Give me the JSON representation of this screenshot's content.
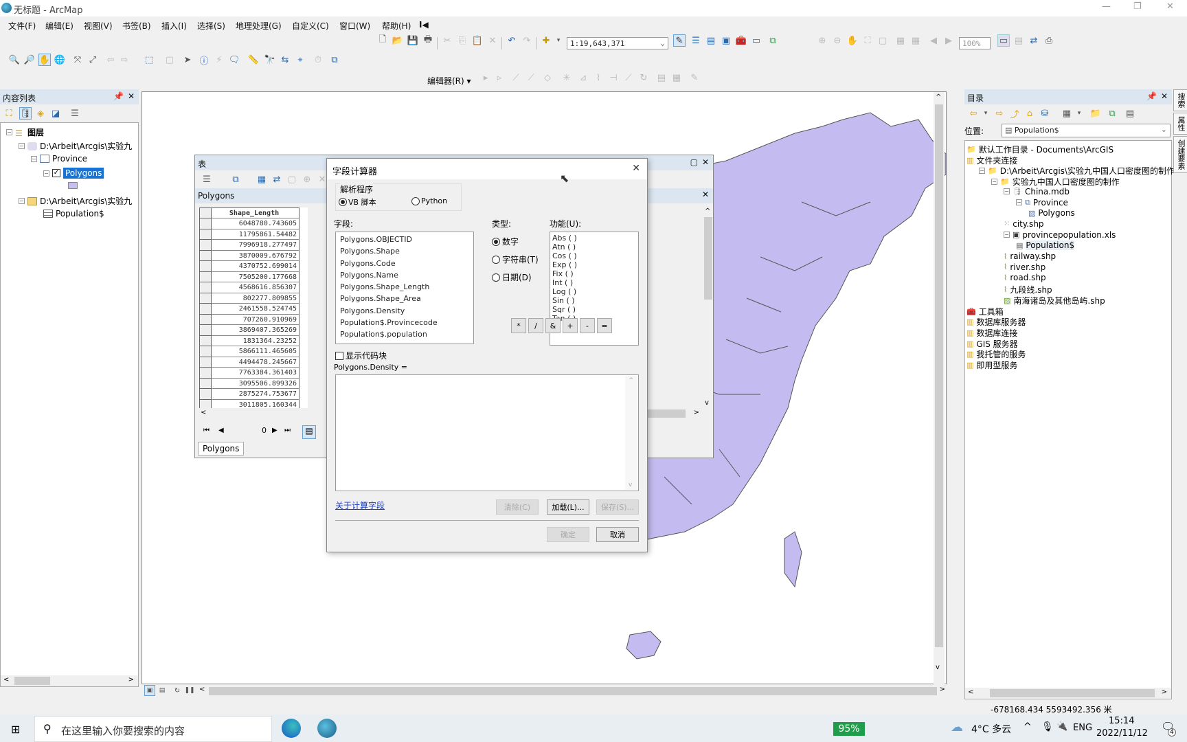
{
  "window": {
    "title": "无标题 - ArcMap"
  },
  "menu": [
    "文件(F)",
    "编辑(E)",
    "视图(V)",
    "书签(B)",
    "插入(I)",
    "选择(S)",
    "地理处理(G)",
    "自定义(C)",
    "窗口(W)",
    "帮助(H)"
  ],
  "toolbar": {
    "scale_value": "1:19,643,371",
    "layout_zoom": "100%",
    "editor_label": "编辑器(R) ▾"
  },
  "toc": {
    "title": "内容列表",
    "root": "图层",
    "items": [
      {
        "label": "D:\\Arbeit\\Arcgis\\实验九",
        "level": 1
      },
      {
        "label": "Province",
        "level": 2
      },
      {
        "label": "Polygons",
        "level": 3,
        "checked": true,
        "selected": true
      },
      {
        "label": "D:\\Arbeit\\Arcgis\\实验九",
        "level": 1
      },
      {
        "label": "Population$",
        "level": 2
      }
    ],
    "symbol_color": "#c8bff0"
  },
  "map": {
    "fill_color": "#c4bcf0",
    "stroke_color": "#555555"
  },
  "table_window": {
    "title": "表",
    "tab_title": "Polygons",
    "column_header": "Shape_Length",
    "rows": [
      "6048780.743605",
      "11795861.54482",
      "7996918.277497",
      "3870009.676792",
      "4370752.699014",
      "7505200.177668",
      "4568616.856307",
      "802277.809855",
      "2461558.524745",
      "707260.910969",
      "3869407.365269",
      "1831364.23252",
      "5866111.465605",
      "4494478.245667",
      "7763384.361403",
      "3095506.899326",
      "2875274.753677",
      "3011805.160344"
    ],
    "record_index": "0",
    "bottom_tab": "Polygons"
  },
  "field_calculator": {
    "title": "字段计算器",
    "parser_label": "解析程序",
    "parser_options": [
      {
        "label": "VB 脚本",
        "selected": true
      },
      {
        "label": "Python",
        "selected": false
      }
    ],
    "fields_label": "字段:",
    "fields": [
      "Polygons.OBJECTID",
      "Polygons.Shape",
      "Polygons.Code",
      "Polygons.Name",
      "Polygons.Shape_Length",
      "Polygons.Shape_Area",
      "Polygons.Density",
      "Population$.Provincecode",
      "Population$.population"
    ],
    "type_label": "类型:",
    "types": [
      {
        "label": "数字",
        "selected": true
      },
      {
        "label": "字符串(T)",
        "selected": false
      },
      {
        "label": "日期(D)",
        "selected": false
      }
    ],
    "functions_label": "功能(U):",
    "functions": [
      "Abs ( )",
      "Atn ( )",
      "Cos ( )",
      "Exp ( )",
      "Fix ( )",
      "Int ( )",
      "Log ( )",
      "Sin ( )",
      "Sqr ( )",
      "Tan ( )"
    ],
    "show_codeblock_label": "显示代码块",
    "show_codeblock_checked": false,
    "operators": [
      "*",
      "/",
      "&",
      "+",
      "-",
      "="
    ],
    "expression_label": "Polygons.Density =",
    "expression_value": "",
    "help_link": "关于计算字段",
    "clear_button": "清除(C)",
    "load_button": "加载(L)...",
    "save_button": "保存(S)...",
    "ok_button": "确定",
    "cancel_button": "取消"
  },
  "catalog": {
    "title": "目录",
    "location_label": "位置:",
    "location_value": "Population$",
    "items": [
      {
        "label": "默认工作目录 - Documents\\ArcGIS",
        "level": 0
      },
      {
        "label": "文件夹连接",
        "level": 0
      },
      {
        "label": "D:\\Arbeit\\Arcgis\\实验九中国人口密度图的制作",
        "level": 1
      },
      {
        "label": "实验九中国人口密度图的制作",
        "level": 2
      },
      {
        "label": "China.mdb",
        "level": 3
      },
      {
        "label": "Province",
        "level": 4
      },
      {
        "label": "Polygons",
        "level": 5
      },
      {
        "label": "city.shp",
        "level": 3
      },
      {
        "label": "provincepopulation.xls",
        "level": 3
      },
      {
        "label": "Population$",
        "level": 4,
        "selected": true
      },
      {
        "label": "railway.shp",
        "level": 3
      },
      {
        "label": "river.shp",
        "level": 3
      },
      {
        "label": "road.shp",
        "level": 3
      },
      {
        "label": "九段线.shp",
        "level": 3
      },
      {
        "label": "南海诸岛及其他岛屿.shp",
        "level": 3
      },
      {
        "label": "工具箱",
        "level": 0
      },
      {
        "label": "数据库服务器",
        "level": 0
      },
      {
        "label": "数据库连接",
        "level": 0
      },
      {
        "label": "GIS 服务器",
        "level": 0
      },
      {
        "label": "我托管的服务",
        "level": 0
      },
      {
        "label": "即用型服务",
        "level": 0
      }
    ],
    "side_tabs": [
      "搜索",
      "属性",
      "创建要素"
    ]
  },
  "status": {
    "coordinates": "-678168.434  5593492.356 米"
  },
  "taskbar": {
    "search_placeholder": "在这里输入你要搜索的内容",
    "battery": "95%",
    "weather": "4°C 多云",
    "lang": "ENG",
    "time": "15:14",
    "date": "2022/11/12",
    "notifications": "4"
  }
}
